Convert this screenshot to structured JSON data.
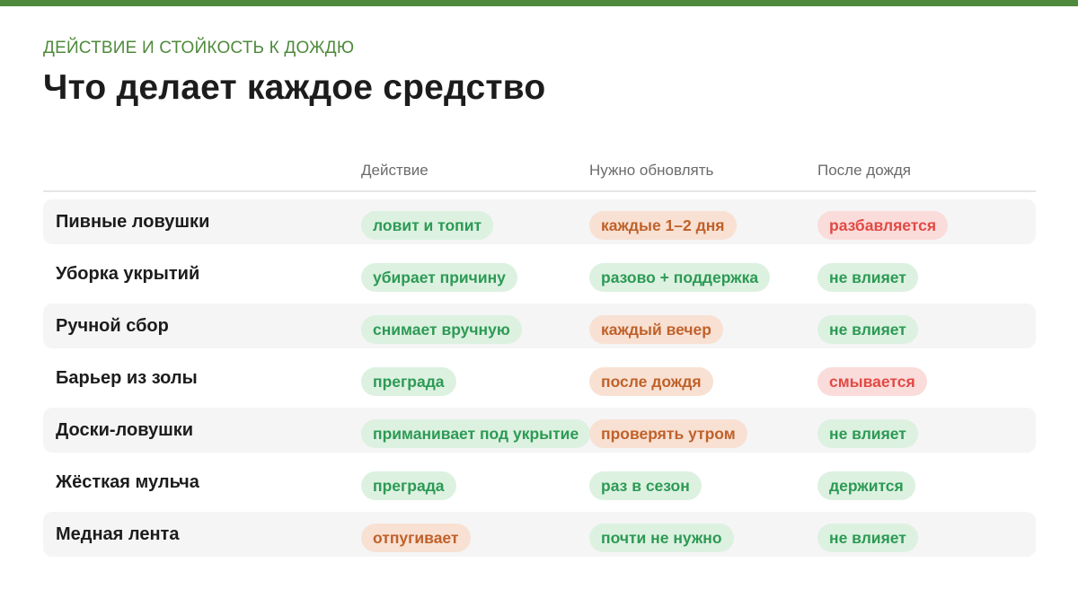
{
  "header": {
    "eyebrow": "ДЕЙСТВИЕ И СТОЙКОСТЬ К ДОЖДЮ",
    "title": "Что делает каждое средство"
  },
  "columns": [
    "Действие",
    "Нужно обновлять",
    "После дождя"
  ],
  "colors": {
    "accent": "#4f8a3c",
    "green_bg": "#ddf1e1",
    "green_text": "#2c9a54",
    "orange_bg": "#f8e1d3",
    "orange_text": "#c0612a",
    "red_bg": "#fadcdb",
    "red_text": "#e14a43"
  },
  "rows": [
    {
      "label": "Пивные ловушки",
      "cells": [
        {
          "text": "ловит и топит",
          "tone": "green"
        },
        {
          "text": "каждые 1–2 дня",
          "tone": "orange"
        },
        {
          "text": "разбавляется",
          "tone": "red"
        }
      ]
    },
    {
      "label": "Уборка укрытий",
      "cells": [
        {
          "text": "убирает причину",
          "tone": "green"
        },
        {
          "text": "разово + поддержка",
          "tone": "green"
        },
        {
          "text": "не влияет",
          "tone": "green"
        }
      ]
    },
    {
      "label": "Ручной сбор",
      "cells": [
        {
          "text": "снимает вручную",
          "tone": "green"
        },
        {
          "text": "каждый вечер",
          "tone": "orange"
        },
        {
          "text": "не влияет",
          "tone": "green"
        }
      ]
    },
    {
      "label": "Барьер из золы",
      "cells": [
        {
          "text": "преграда",
          "tone": "green"
        },
        {
          "text": "после дождя",
          "tone": "orange"
        },
        {
          "text": "смывается",
          "tone": "red"
        }
      ]
    },
    {
      "label": "Доски-ловушки",
      "cells": [
        {
          "text": "приманивает под укрытие",
          "tone": "green"
        },
        {
          "text": "проверять утром",
          "tone": "orange"
        },
        {
          "text": "не влияет",
          "tone": "green"
        }
      ]
    },
    {
      "label": "Жёсткая мульча",
      "cells": [
        {
          "text": "преграда",
          "tone": "green"
        },
        {
          "text": "раз в сезон",
          "tone": "green"
        },
        {
          "text": "держится",
          "tone": "green"
        }
      ]
    },
    {
      "label": "Медная лента",
      "cells": [
        {
          "text": "отпугивает",
          "tone": "orange"
        },
        {
          "text": "почти не нужно",
          "tone": "green"
        },
        {
          "text": "не влияет",
          "tone": "green"
        }
      ]
    }
  ]
}
